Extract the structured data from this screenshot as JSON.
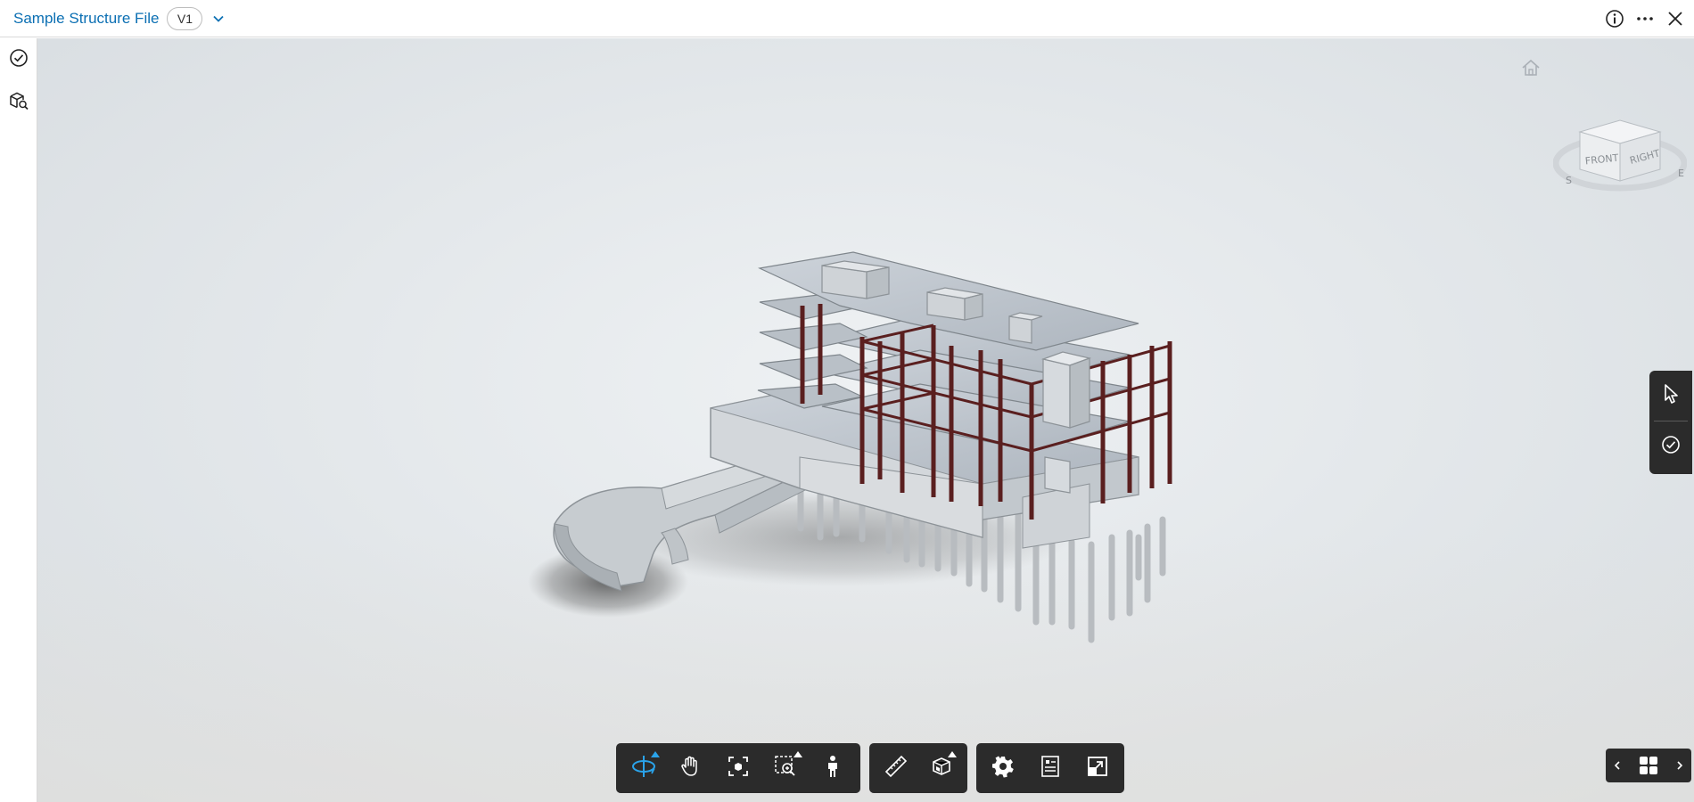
{
  "header": {
    "title": "Sample Structure File",
    "version": "V1",
    "icons": [
      "chevron-down-icon",
      "info-icon",
      "more-icon",
      "close-icon"
    ]
  },
  "left_rail": {
    "items": [
      {
        "name": "issues",
        "icon": "check-circle-icon"
      },
      {
        "name": "model-browser",
        "icon": "model-search-icon"
      }
    ]
  },
  "viewcube": {
    "faces": [
      "FRONT",
      "RIGHT"
    ],
    "compass": [
      "S",
      "E"
    ]
  },
  "right_toolbar": {
    "items": [
      {
        "name": "select",
        "icon": "pointer-icon"
      },
      {
        "name": "issues",
        "icon": "check-circle-icon"
      }
    ]
  },
  "bottom_toolbar": {
    "groups": [
      [
        {
          "name": "orbit",
          "icon": "orbit-icon",
          "active": true,
          "flyout": true
        },
        {
          "name": "pan",
          "icon": "hand-icon",
          "active": false,
          "flyout": false
        },
        {
          "name": "fit-to-view",
          "icon": "fit-view-icon",
          "active": false,
          "flyout": false
        },
        {
          "name": "zoom-window",
          "icon": "zoom-window-icon",
          "active": false,
          "flyout": true
        },
        {
          "name": "first-person",
          "icon": "person-icon",
          "active": false,
          "flyout": false
        }
      ],
      [
        {
          "name": "measure",
          "icon": "ruler-icon",
          "active": false,
          "flyout": false
        },
        {
          "name": "section",
          "icon": "section-box-icon",
          "active": false,
          "flyout": true
        }
      ],
      [
        {
          "name": "settings",
          "icon": "gear-icon",
          "active": false,
          "flyout": false
        },
        {
          "name": "properties",
          "icon": "properties-icon",
          "active": false,
          "flyout": false
        },
        {
          "name": "full-screen",
          "icon": "expand-icon",
          "active": false,
          "flyout": false
        }
      ]
    ]
  },
  "pager": {
    "icons": [
      "chevron-left-icon",
      "grid-icon",
      "chevron-right-icon"
    ]
  },
  "colors": {
    "accent": "#0b6fb3",
    "active_tool": "#2aa3ea",
    "toolbar_bg": "#2b2b2b",
    "steel": "#5a1f1f",
    "concrete": "#c9ced3"
  }
}
